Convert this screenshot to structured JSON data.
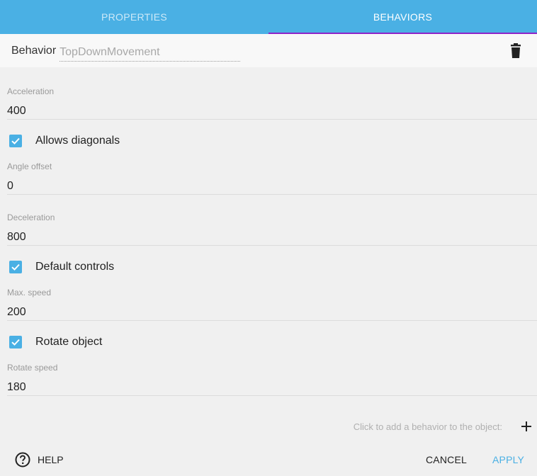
{
  "tabs": [
    {
      "label": "PROPERTIES",
      "active": false
    },
    {
      "label": "BEHAVIORS",
      "active": true
    }
  ],
  "behavior": {
    "label": "Behavior",
    "name": "TopDownMovement",
    "delete_icon": "trash-icon"
  },
  "fields": {
    "acceleration": {
      "label": "Acceleration",
      "value": "400"
    },
    "allows_diagonals": {
      "label": "Allows diagonals",
      "checked": true
    },
    "angle_offset": {
      "label": "Angle offset",
      "value": "0"
    },
    "deceleration": {
      "label": "Deceleration",
      "value": "800"
    },
    "default_controls": {
      "label": "Default controls",
      "checked": true
    },
    "max_speed": {
      "label": "Max. speed",
      "value": "200"
    },
    "rotate_object": {
      "label": "Rotate object",
      "checked": true
    },
    "rotate_speed": {
      "label": "Rotate speed",
      "value": "180"
    }
  },
  "add_behavior": {
    "text": "Click to add a behavior to the object:",
    "icon": "plus-icon"
  },
  "footer": {
    "help_label": "HELP",
    "help_icon": "help-circle-icon",
    "cancel_label": "CANCEL",
    "apply_label": "APPLY"
  },
  "colors": {
    "accent": "#4ab0e4",
    "tab_indicator": "#8e24c8"
  }
}
